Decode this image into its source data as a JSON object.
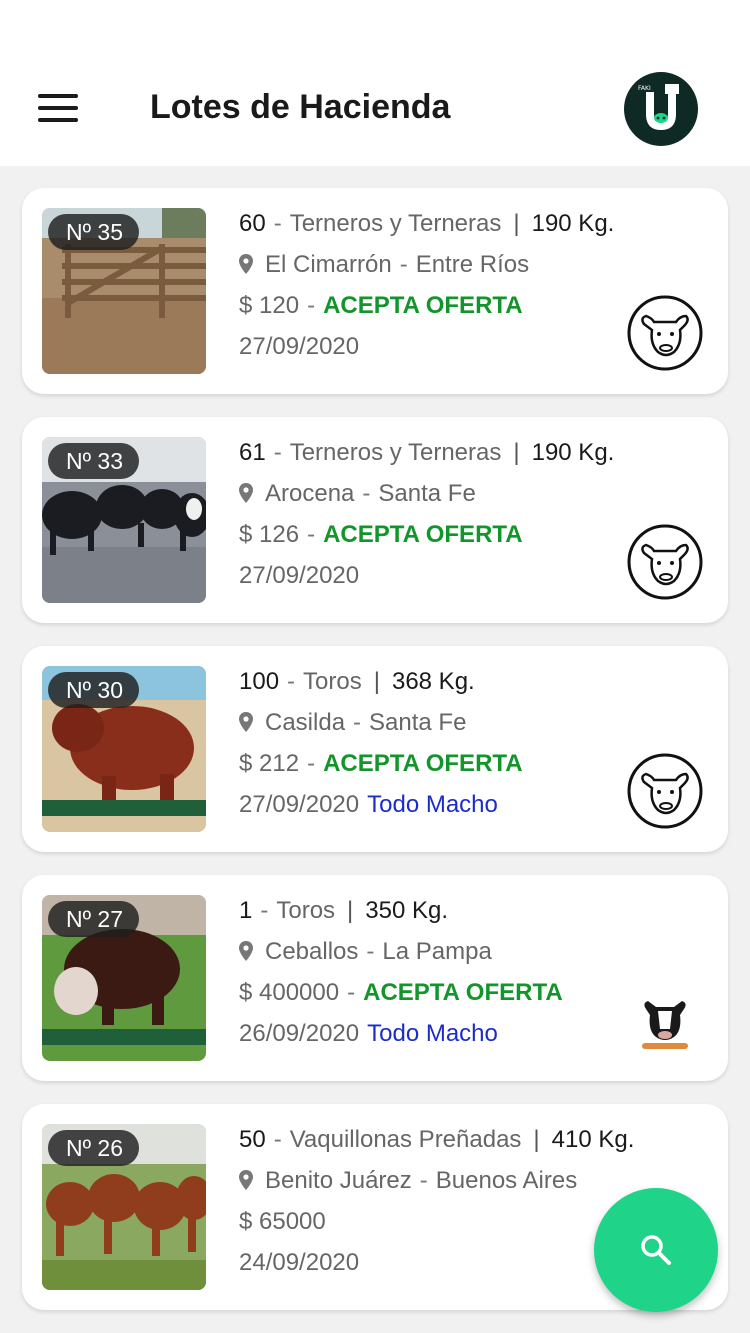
{
  "header": {
    "title": "Lotes de Hacienda",
    "menu_icon": "hamburger-menu-icon",
    "logo_icon": "brand-logo-icon"
  },
  "lots": [
    {
      "badge": "Nº 35",
      "qty": "60",
      "category": "Terneros y Terneras",
      "weight": "190 Kg.",
      "city": "El Cimarrón",
      "province": "Entre Ríos",
      "price": "$ 120",
      "offer": "ACEPTA OFERTA",
      "date": "27/09/2020",
      "tag": ""
    },
    {
      "badge": "Nº 33",
      "qty": "61",
      "category": "Terneros y Terneras",
      "weight": "190 Kg.",
      "city": "Arocena",
      "province": "Santa Fe",
      "price": "$ 126",
      "offer": "ACEPTA OFERTA",
      "date": "27/09/2020",
      "tag": ""
    },
    {
      "badge": "Nº 30",
      "qty": "100",
      "category": "Toros",
      "weight": "368 Kg.",
      "city": "Casilda",
      "province": "Santa Fe",
      "price": "$ 212",
      "offer": "ACEPTA OFERTA",
      "date": "27/09/2020",
      "tag": "Todo Macho"
    },
    {
      "badge": "Nº 27",
      "qty": "1",
      "category": "Toros",
      "weight": "350 Kg.",
      "city": "Ceballos",
      "province": "La Pampa",
      "price": "$ 400000",
      "offer": "ACEPTA OFERTA",
      "date": "26/09/2020",
      "tag": "Todo Macho"
    },
    {
      "badge": "Nº 26",
      "qty": "50",
      "category": "Vaquillonas Preñadas",
      "weight": "410 Kg.",
      "city": "Benito Juárez",
      "province": "Buenos Aires",
      "price": "$ 65000",
      "offer": "",
      "date": "24/09/2020",
      "tag": ""
    }
  ],
  "search_fab": {
    "icon": "search-icon"
  },
  "colors": {
    "offer": "#12952a",
    "tag": "#1c2ccb",
    "fab": "#1fd389",
    "logo_bg": "#0f2a24"
  }
}
